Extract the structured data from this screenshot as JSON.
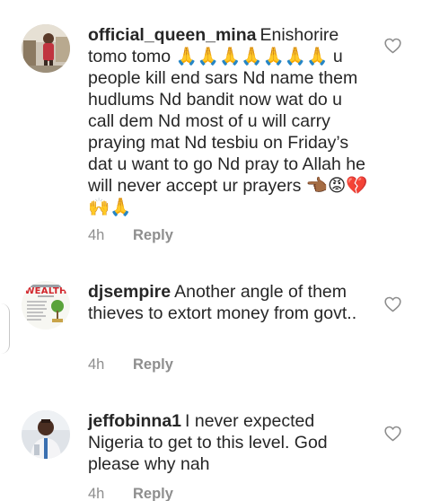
{
  "comments": [
    {
      "username": "official_queen_mina",
      "text": "Enishorire tomo tomo 🙏🙏🙏🙏🙏🙏🙏 u people kill end sars Nd name them hudlums Nd bandit now wat do u call dem Nd most of u will carry praying mat Nd tesbiu on Friday’s dat u want to go Nd pray to Allah he will never accept ur prayers 👈🏾😡💔🙌🙏",
      "time": "4h",
      "reply_label": "Reply",
      "avatar_icon": "user-photo-room"
    },
    {
      "username": "djsempire",
      "text": "Another angle of them thieves to extort money from govt..",
      "time": "4h",
      "reply_label": "Reply",
      "avatar_icon": "wealth-poster",
      "avatar_word": "WEALTH"
    },
    {
      "username": "jeffobinna1",
      "text": "I never expected Nigeria to get to this level. God please why nah",
      "time": "4h",
      "reply_label": "Reply",
      "avatar_icon": "user-photo-man"
    }
  ],
  "colors": {
    "text": "#262626",
    "secondary": "#8e8e8e",
    "heart": "#8e8e8e"
  }
}
